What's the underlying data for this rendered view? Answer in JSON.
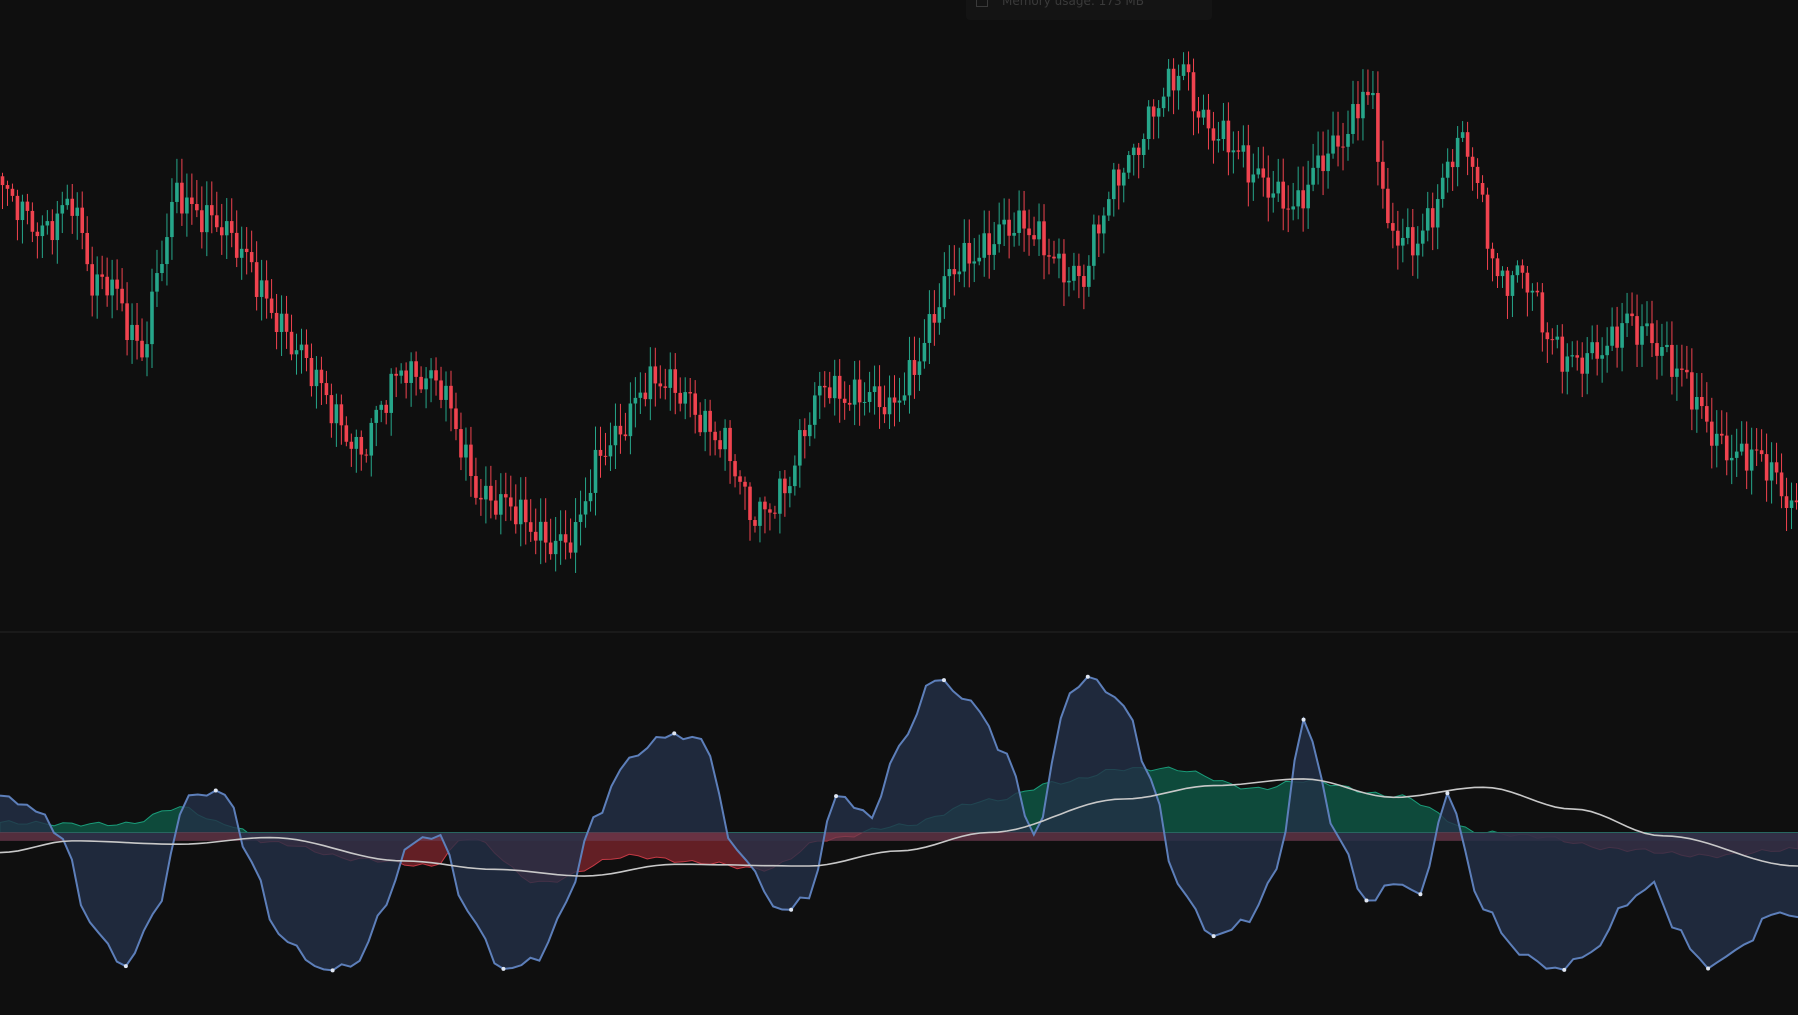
{
  "tooltip": {
    "icon": "chip-icon",
    "text": "Memory usage: 173 MB"
  },
  "colors": {
    "background": "#0f0f0f",
    "up": "#26a68a",
    "down": "#f0434f",
    "divider": "#262626",
    "oscillator_line": "#5d7fba",
    "oscillator_fill": "#233047",
    "signal_line": "#c8c8c8",
    "hist_pos": "#0e4a3b",
    "hist_pos_line": "#1a9c79",
    "hist_neg": "#631f25",
    "hist_neg_line": "#c53a45",
    "zero_band": "#6b3a4e",
    "pivot": "#dfe6f2"
  },
  "chart_data": [
    {
      "type": "candlestick",
      "ylim": [
        0,
        100
      ],
      "candles": []
    },
    {
      "type": "line",
      "ylim": [
        -100,
        100
      ],
      "zero_band": [
        -5,
        0
      ],
      "oscillator": [],
      "signal": [],
      "histogram": []
    }
  ]
}
